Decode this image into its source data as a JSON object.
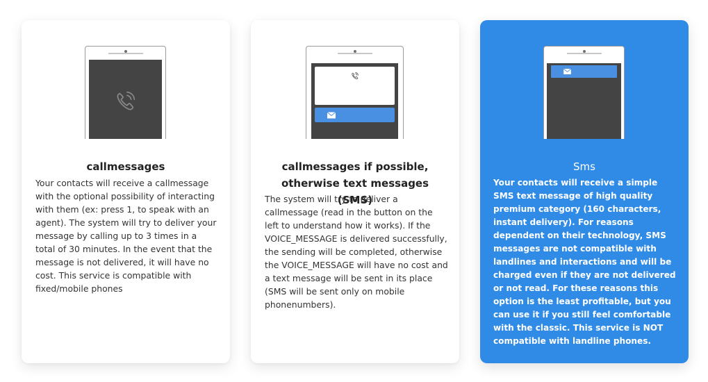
{
  "cards": [
    {
      "title": "callmessages",
      "description": "Your contacts will receive a callmessage with the optional possibility of interacting with them (ex: press 1, to speak with an agent). The system will try to deliver your message by calling up to 3 times in a total of 30 minutes. In the event that the message is not delivered, it will have no cost. This service is compatible with fixed/mobile phones",
      "icon": "phone-call-icon"
    },
    {
      "title": "callmessages if possible, otherwise text messages (SMS)",
      "description": "The system will try to deliver a callmessage (read in the button on the left to understand how it works). If the VOICE_MESSAGE is delivered successfully, the sending will be completed, otherwise the VOICE_MESSAGE will have no cost and a text message will be sent in its place (SMS will be sent only on mobile phonenumbers).",
      "icon": "phone-call-and-mail-icon"
    },
    {
      "title": "Sms",
      "description": "Your contacts will receive a simple SMS text message of high quality premium category (160 characters, instant delivery). For reasons dependent on their technology, SMS messages are not compatible with landlines and interactions and will be charged even if they are not delivered or not read. For these reasons this option is the least profitable, but you can use it if you still feel comfortable with the classic. This service is NOT compatible with landline phones.",
      "icon": "mail-icon",
      "selected": true
    }
  ],
  "colors": {
    "selected_bg": "#2f8be6",
    "accent_bar": "#4a90e2",
    "screen": "#444444",
    "card_bg": "#ffffff"
  }
}
